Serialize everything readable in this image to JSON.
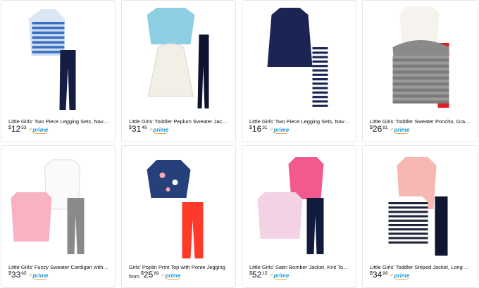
{
  "products": [
    {
      "title": "Little Girls' Two Piece Legging Sets, Navy, 5",
      "from": "",
      "currency": "$",
      "dollars": "12",
      "cents": "53",
      "prime": "prime",
      "icon": "tank-top-legging-set-icon"
    },
    {
      "title": "Little Girls' Toddler Peplum Sweater Jacket ...",
      "from": "",
      "currency": "$",
      "dollars": "31",
      "cents": "49",
      "prime": "prime",
      "icon": "sweater-jacket-set-icon"
    },
    {
      "title": "Little Girls' Two Piece Legging Sets, Navy, 5",
      "from": "",
      "currency": "$",
      "dollars": "16",
      "cents": "31",
      "prime": "prime",
      "icon": "navy-top-striped-legging-icon"
    },
    {
      "title": "Little Girls' Toddler Sweater Poncho, Graph...",
      "from": "",
      "currency": "$",
      "dollars": "26",
      "cents": "81",
      "prime": "prime",
      "icon": "sweater-poncho-set-icon"
    },
    {
      "title": "Little Girls' Fuzzy Sweater Cardigan with Fo...",
      "from": "",
      "currency": "$",
      "dollars": "33",
      "cents": "65",
      "prime": "prime",
      "icon": "fuzzy-cardigan-set-icon"
    },
    {
      "title": "Girls' Poplin Print Top with Ponte Jegging",
      "from": "from",
      "currency": "$",
      "dollars": "25",
      "cents": "89",
      "prime": "prime",
      "icon": "poplin-top-jegging-icon"
    },
    {
      "title": "Little Girls' Satin Bomber Jacket, Knit Top a...",
      "from": "",
      "currency": "$",
      "dollars": "52",
      "cents": "15",
      "prime": "prime",
      "icon": "bomber-jacket-set-icon"
    },
    {
      "title": "Little Girls' Toddler Striped Jacket, Long Sle...",
      "from": "",
      "currency": "$",
      "dollars": "34",
      "cents": "99",
      "prime": "prime",
      "icon": "striped-jacket-set-icon"
    }
  ],
  "colors": {
    "prime_blue": "#1a98d5",
    "prime_orange": "#f3a847",
    "card_border": "#e6e6e6"
  }
}
